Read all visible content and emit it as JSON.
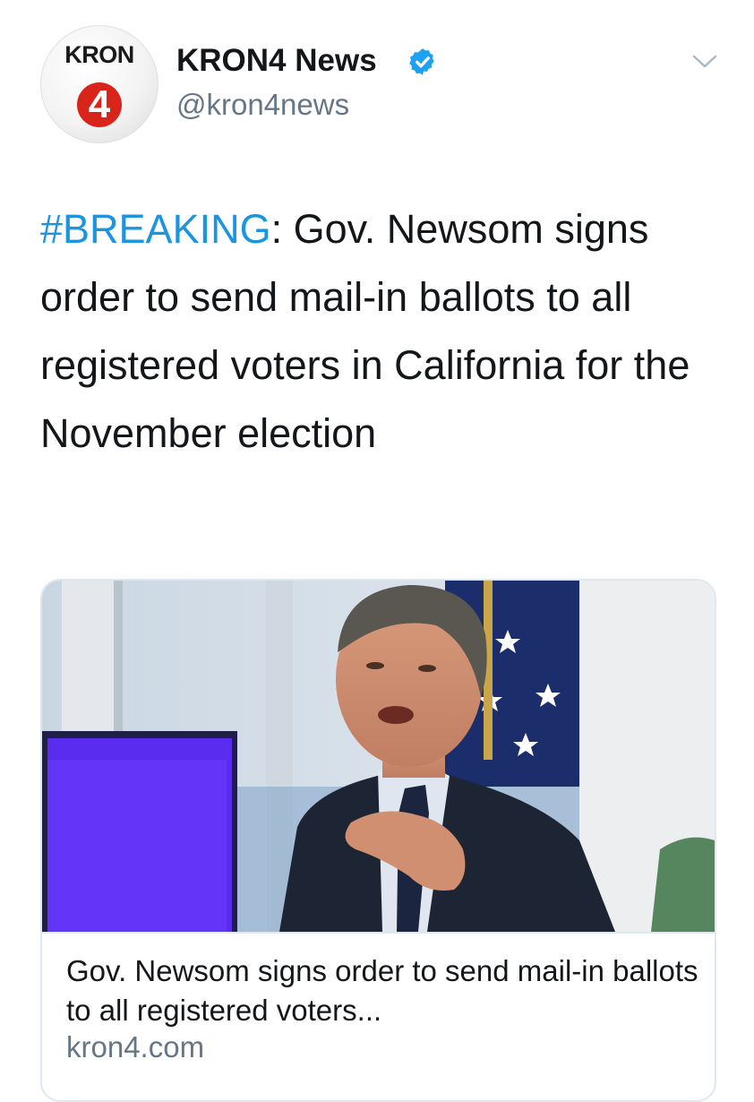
{
  "account": {
    "avatar_text": "KRON",
    "avatar_number": "4",
    "display_name": "KRON4 News",
    "handle": "@kron4news",
    "verified": true
  },
  "icons": {
    "verified": "verified-badge-icon",
    "menu": "chevron-down-icon"
  },
  "tweet": {
    "hashtag": "#BREAKING",
    "body": ": Gov. Newsom signs order to send mail-in ballots to all registered voters in California for the November election"
  },
  "card": {
    "title": "Gov. Newsom signs order to send mail-in ballots to all registered voters...",
    "domain": "kron4.com"
  },
  "colors": {
    "hashtag": "#1b95e0",
    "verified": "#1da1f2",
    "secondary_text": "#657786",
    "card_border": "#e1e8ed",
    "logo_red": "#d9241c"
  }
}
